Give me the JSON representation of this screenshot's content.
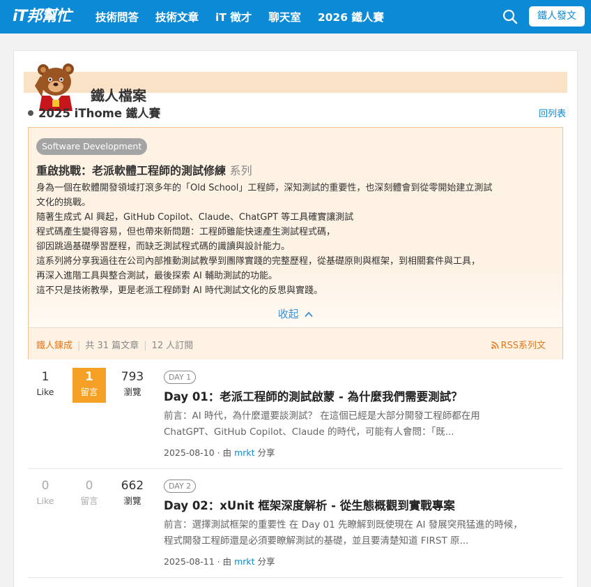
{
  "nav": {
    "logo": "iT邦幫忙",
    "links": [
      "技術問答",
      "技術文章",
      "iT 徵才",
      "聊天室",
      "2026 鐵人賽"
    ],
    "post_button": "鐵人發文"
  },
  "banner": {
    "title": "鐵人檔案"
  },
  "series_header": {
    "contest": "2025 iThome 鐵人賽",
    "back_link": "回列表"
  },
  "series": {
    "tag": "Software Development",
    "title": "重啟挑戰：老派軟體工程師的測試修練",
    "title_suffix": "系列",
    "description": [
      "身為一個在軟體開發領域打滾多年的「Old School」工程師，深知測試的重要性，也深刻體會到從零開始建立測試",
      "文化的挑戰。",
      "隨著生成式 AI 興起，GitHub Copilot、Claude、ChatGPT 等工具確實讓測試",
      "程式碼產生變得容易，但也帶來新問題：工程師雖能快速產生測試程式碼，",
      "卻因跳過基礎學習歷程，而缺乏測試程式碼的識讀與設計能力。",
      "這系列將分享我過往在公司內部推動測試教學到團隊實踐的完整歷程，從基礎原則與框架，到相關套件與工具，",
      "再深入進階工具與整合測試，最後探索 AI 輔助測試的功能。",
      "這不只是技術教學，更是老派工程師對 AI 時代測試文化的反思與實踐。"
    ],
    "collapse_label": "收起",
    "footer": {
      "status": "鐵人鍊成",
      "article_count": "共 31 篇文章",
      "subscribers": "12 人訂閱",
      "rss": "RSS系列文"
    }
  },
  "articles": [
    {
      "likes": "1",
      "likes_label": "Like",
      "comments": "1",
      "comments_label": "留言",
      "views": "793",
      "views_label": "瀏覽",
      "day": "DAY 1",
      "title": "Day 01：老派工程師的測試啟蒙 - 為什麼我們需要測試？",
      "excerpt": [
        "前言：AI 時代，為什麼還要談測試？ 在這個已經是大部分開發工程師都在用",
        "ChatGPT、GitHub Copilot、Claude 的時代，可能有人會問：「既..."
      ],
      "date": "2025-08-10",
      "by": "由",
      "author": "mrkt",
      "share": "分享"
    },
    {
      "likes": "0",
      "likes_label": "Like",
      "comments": "0",
      "comments_label": "留言",
      "views": "662",
      "views_label": "瀏覽",
      "day": "DAY 2",
      "title": "Day 02：xUnit 框架深度解析 - 從生態概觀到實戰專案",
      "excerpt": [
        "前言：選擇測試框架的重要性 在 Day 01 先瞭解到既使現在 AI 發展突飛猛進的時候，",
        "程式開發工程師還是必須要瞭解測試的基礎，並且要清楚知道 FIRST 原..."
      ],
      "date": "2025-08-11",
      "by": "由",
      "author": "mrkt",
      "share": "分享"
    }
  ]
}
